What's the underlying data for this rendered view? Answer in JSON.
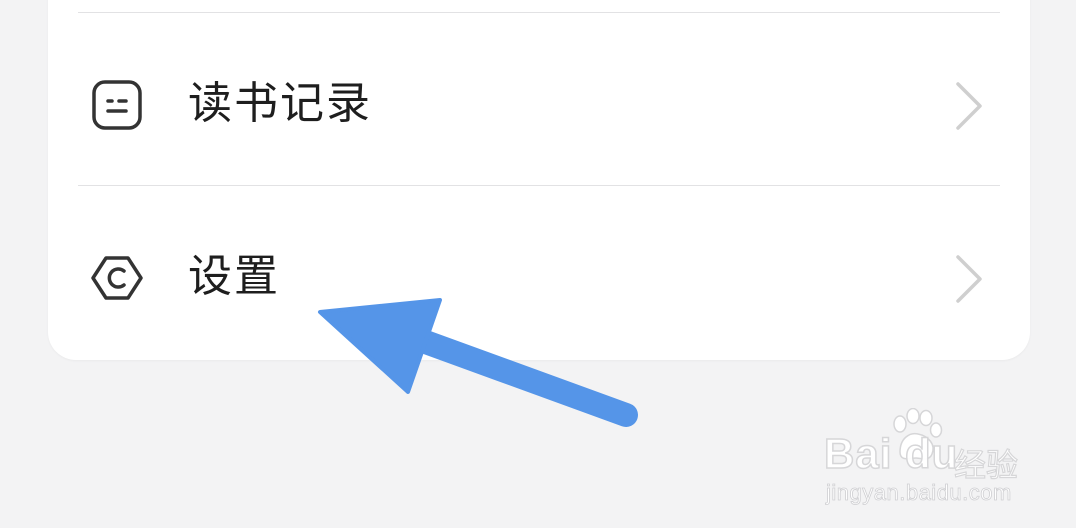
{
  "menu": {
    "items": [
      {
        "label": "读书记录",
        "icon": "reading-record-icon"
      },
      {
        "label": "设置",
        "icon": "settings-hexagon-icon"
      }
    ]
  },
  "annotation": {
    "arrow_color": "#5595e8",
    "icon": "pointer-arrow-icon"
  },
  "watermark": {
    "brand": "Bai du",
    "product": "经验",
    "url": "jingyan.baidu.com"
  },
  "colors": {
    "background": "#f3f3f4",
    "card": "#ffffff",
    "text": "#1e1e1e",
    "icon": "#333333",
    "chevron": "#cfcfcf"
  }
}
